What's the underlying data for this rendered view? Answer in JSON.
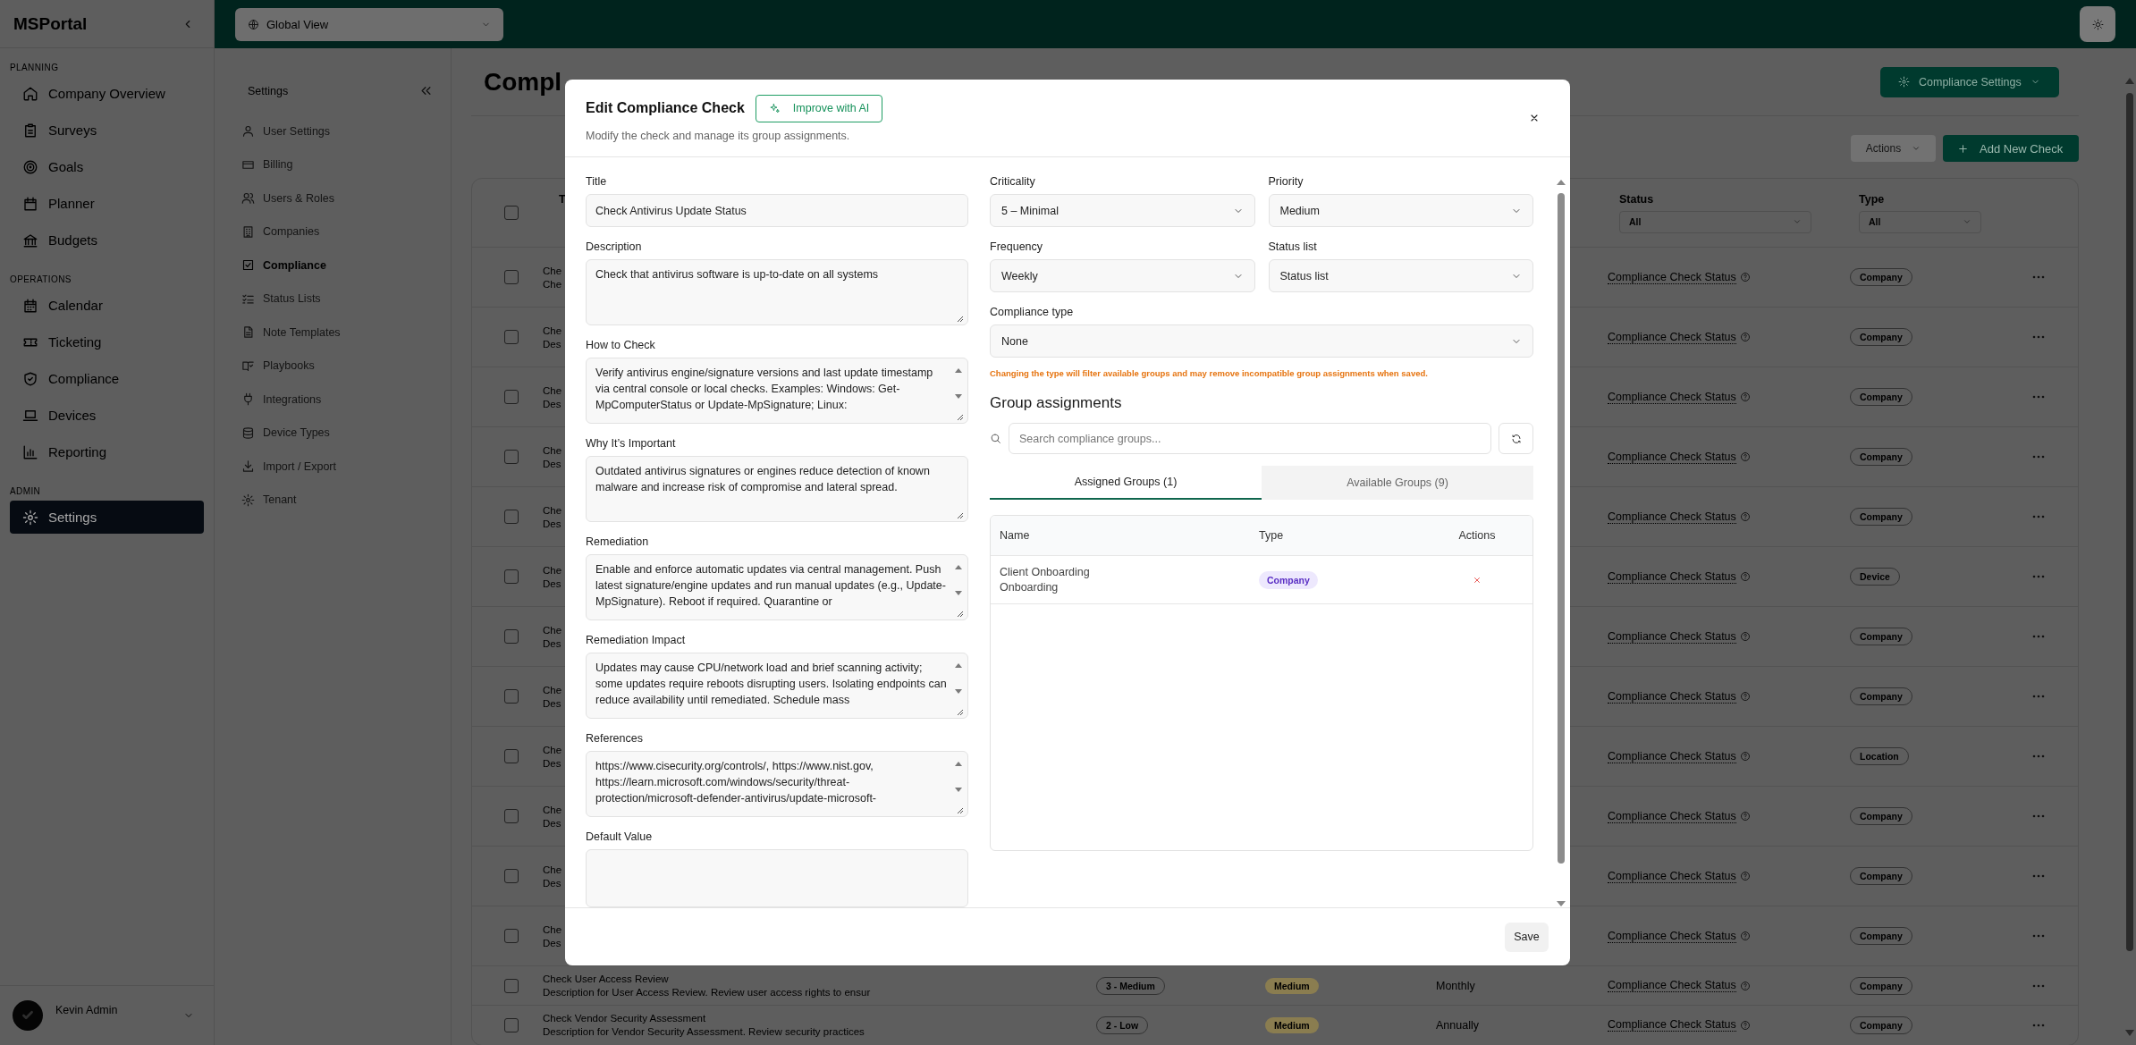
{
  "sidebar": {
    "brand": "MSPortal",
    "sections": [
      {
        "label": "PLANNING",
        "items": [
          {
            "label": "Company Overview",
            "selected": false
          },
          {
            "label": "Surveys",
            "selected": false
          },
          {
            "label": "Goals",
            "selected": false
          },
          {
            "label": "Planner",
            "selected": false
          },
          {
            "label": "Budgets",
            "selected": false
          }
        ]
      },
      {
        "label": "OPERATIONS",
        "items": [
          {
            "label": "Calendar",
            "selected": false
          },
          {
            "label": "Ticketing",
            "selected": false
          },
          {
            "label": "Compliance",
            "selected": false
          },
          {
            "label": "Devices",
            "selected": false
          },
          {
            "label": "Reporting",
            "selected": false
          }
        ]
      },
      {
        "label": "ADMIN",
        "items": [
          {
            "label": "Settings",
            "selected": true
          }
        ]
      }
    ],
    "user": {
      "name": "Kevin Admin"
    }
  },
  "topbar": {
    "scope": "Global View"
  },
  "settings_nav": {
    "title": "Settings",
    "items": [
      {
        "label": "User Settings",
        "selected": false
      },
      {
        "label": "Billing",
        "selected": false
      },
      {
        "label": "Users & Roles",
        "selected": false
      },
      {
        "label": "Companies",
        "selected": false
      },
      {
        "label": "Compliance",
        "selected": true
      },
      {
        "label": "Status Lists",
        "selected": false
      },
      {
        "label": "Note Templates",
        "selected": false
      },
      {
        "label": "Playbooks",
        "selected": false
      },
      {
        "label": "Integrations",
        "selected": false
      },
      {
        "label": "Device Types",
        "selected": false
      },
      {
        "label": "Import / Export",
        "selected": false
      },
      {
        "label": "Tenant",
        "selected": false
      }
    ]
  },
  "page": {
    "title": "Compl",
    "settings_button": "Compliance Settings",
    "actions_button": {
      "label": "Actions",
      "disabled": true
    },
    "add_button": "Add New Check"
  },
  "table": {
    "select_all": {
      "checked": false
    },
    "columns": [
      {
        "label": "T"
      },
      {
        "label": "Status",
        "filter": "All"
      },
      {
        "label": "Type",
        "filter": "All"
      }
    ],
    "rows": [
      {
        "checked": false,
        "title": "Che",
        "description": "Che",
        "status": "Compliance Check Status",
        "type": "Company"
      },
      {
        "checked": false,
        "title": "Che",
        "description": "Des",
        "status": "Compliance Check Status",
        "type": "Company"
      },
      {
        "checked": false,
        "title": "Che",
        "description": "Des",
        "status": "Compliance Check Status",
        "type": "Company"
      },
      {
        "checked": false,
        "title": "Che",
        "description": "Des",
        "status": "Compliance Check Status",
        "type": "Company"
      },
      {
        "checked": false,
        "title": "Che",
        "description": "Des",
        "status": "Compliance Check Status",
        "type": "Company"
      },
      {
        "checked": false,
        "title": "Che",
        "description": "Des",
        "status": "Compliance Check Status",
        "type": "Device"
      },
      {
        "checked": false,
        "title": "Che",
        "description": "Des",
        "status": "Compliance Check Status",
        "type": "Company"
      },
      {
        "checked": false,
        "title": "Che",
        "description": "Des",
        "status": "Compliance Check Status",
        "type": "Company"
      },
      {
        "checked": false,
        "title": "Che",
        "description": "Des",
        "status": "Compliance Check Status",
        "type": "Location"
      },
      {
        "checked": false,
        "title": "Che",
        "description": "Des",
        "status": "Compliance Check Status",
        "type": "Company"
      },
      {
        "checked": false,
        "title": "Che",
        "description": "Des",
        "status": "Compliance Check Status",
        "type": "Company"
      },
      {
        "checked": false,
        "title": "Che",
        "description": "Des",
        "status": "Compliance Check Status",
        "type": "Company"
      },
      {
        "checked": false,
        "title": "Check User Access Review",
        "description": "Description for User Access Review. Review user access rights to ensur",
        "criticality": "3 - Medium",
        "priority": "Medium",
        "frequency": "Monthly",
        "status": "Compliance Check Status",
        "type": "Company"
      },
      {
        "checked": false,
        "title": "Check Vendor Security Assessment",
        "description": "Description for Vendor Security Assessment. Review security practices",
        "criticality": "2 - Low",
        "priority": "Medium",
        "frequency": "Annually",
        "status": "Compliance Check Status",
        "type": "Company"
      }
    ]
  },
  "dialog": {
    "title": "Edit Compliance Check",
    "ai_button": "Improve with AI",
    "subtitle": "Modify the check and manage its group assignments.",
    "fields": [
      {
        "label": "Title",
        "kind": "input",
        "value": "Check Antivirus Update Status"
      },
      {
        "label": "Description",
        "kind": "textarea",
        "value": "Check that antivirus software is up-to-date on all systems"
      },
      {
        "label": "How to Check",
        "kind": "scroll",
        "value": "Verify antivirus engine/signature versions and last update timestamp via central console or local checks. Examples: Windows: Get-MpComputerStatus or Update-MpSignature; Linux:"
      },
      {
        "label": "Why It’s Important",
        "kind": "textarea",
        "value": "Outdated antivirus signatures or engines reduce detection of known malware and increase risk of compromise and lateral spread."
      },
      {
        "label": "Remediation",
        "kind": "scroll",
        "value": "Enable and enforce automatic updates via central management. Push latest signature/engine updates and run manual updates (e.g., Update-MpSignature). Reboot if required. Quarantine or"
      },
      {
        "label": "Remediation Impact",
        "kind": "scroll",
        "value": "Updates may cause CPU/network load and brief scanning activity; some updates require reboots disrupting users. Isolating endpoints can reduce availability until remediated. Schedule mass"
      },
      {
        "label": "References",
        "kind": "scroll",
        "value": "https://www.cisecurity.org/controls/, https://www.nist.gov, https://learn.microsoft.com/windows/security/threat-protection/microsoft-defender-antivirus/update-microsoft-"
      },
      {
        "label": "Default Value",
        "kind": "open"
      }
    ],
    "selects": [
      {
        "label": "Criticality",
        "value": "5 – Minimal",
        "wide": false
      },
      {
        "label": "Priority",
        "value": "Medium",
        "wide": false
      },
      {
        "label": "Frequency",
        "value": "Weekly",
        "wide": false
      },
      {
        "label": "Status list",
        "value": "Status list",
        "wide": false
      },
      {
        "label": "Compliance type",
        "value": "None",
        "wide": true
      }
    ],
    "warning": "Changing the type will filter available groups and may remove incompatible group assignments when saved.",
    "groups": {
      "heading": "Group assignments",
      "search_placeholder": "Search compliance groups...",
      "tabs": [
        {
          "label": "Assigned Groups (1)",
          "selected": true
        },
        {
          "label": "Available Groups (9)",
          "selected": false
        }
      ],
      "columns": [
        "Name",
        "Type",
        "Actions"
      ],
      "rows": [
        {
          "name": "Client Onboarding",
          "category": "Onboarding",
          "type": "Company"
        }
      ]
    },
    "save": "Save"
  }
}
